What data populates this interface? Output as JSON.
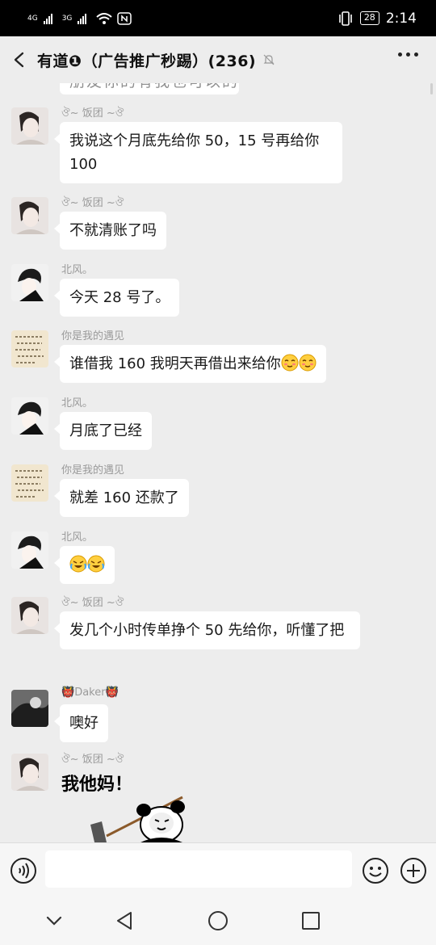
{
  "status": {
    "net1": "4G",
    "net2": "3G",
    "battery": "28",
    "time": "2:14"
  },
  "header": {
    "title": "有道❶（广告推广秒踢）(236)"
  },
  "partial": {
    "text": "朋友你的有我也可以的"
  },
  "messages": [
    {
      "sender": "饭团",
      "text": "我说这个月底先给你 50，15 号再给你 100"
    },
    {
      "sender": "饭团",
      "text": "不就清账了吗"
    },
    {
      "sender": "北风。",
      "text": "今天 28 号了。"
    },
    {
      "sender": "你是我的遇见",
      "text": "谁借我 160 我明天再借出来给你"
    },
    {
      "sender": "北风。",
      "text": "月底了已经"
    },
    {
      "sender": "你是我的遇见",
      "text": "就差 160 还款了"
    },
    {
      "sender": "北风。",
      "text": ""
    },
    {
      "sender": "饭团",
      "text": "发几个小时传单挣个 50 先给你，听懂了把"
    },
    {
      "sender": "Daker",
      "text": "噢好"
    },
    {
      "sender": "饭团",
      "sticker_text": "我他妈！"
    }
  ],
  "colors": {
    "background": "#ededed",
    "bubble": "#ffffff",
    "nick": "#9a9a9a"
  }
}
